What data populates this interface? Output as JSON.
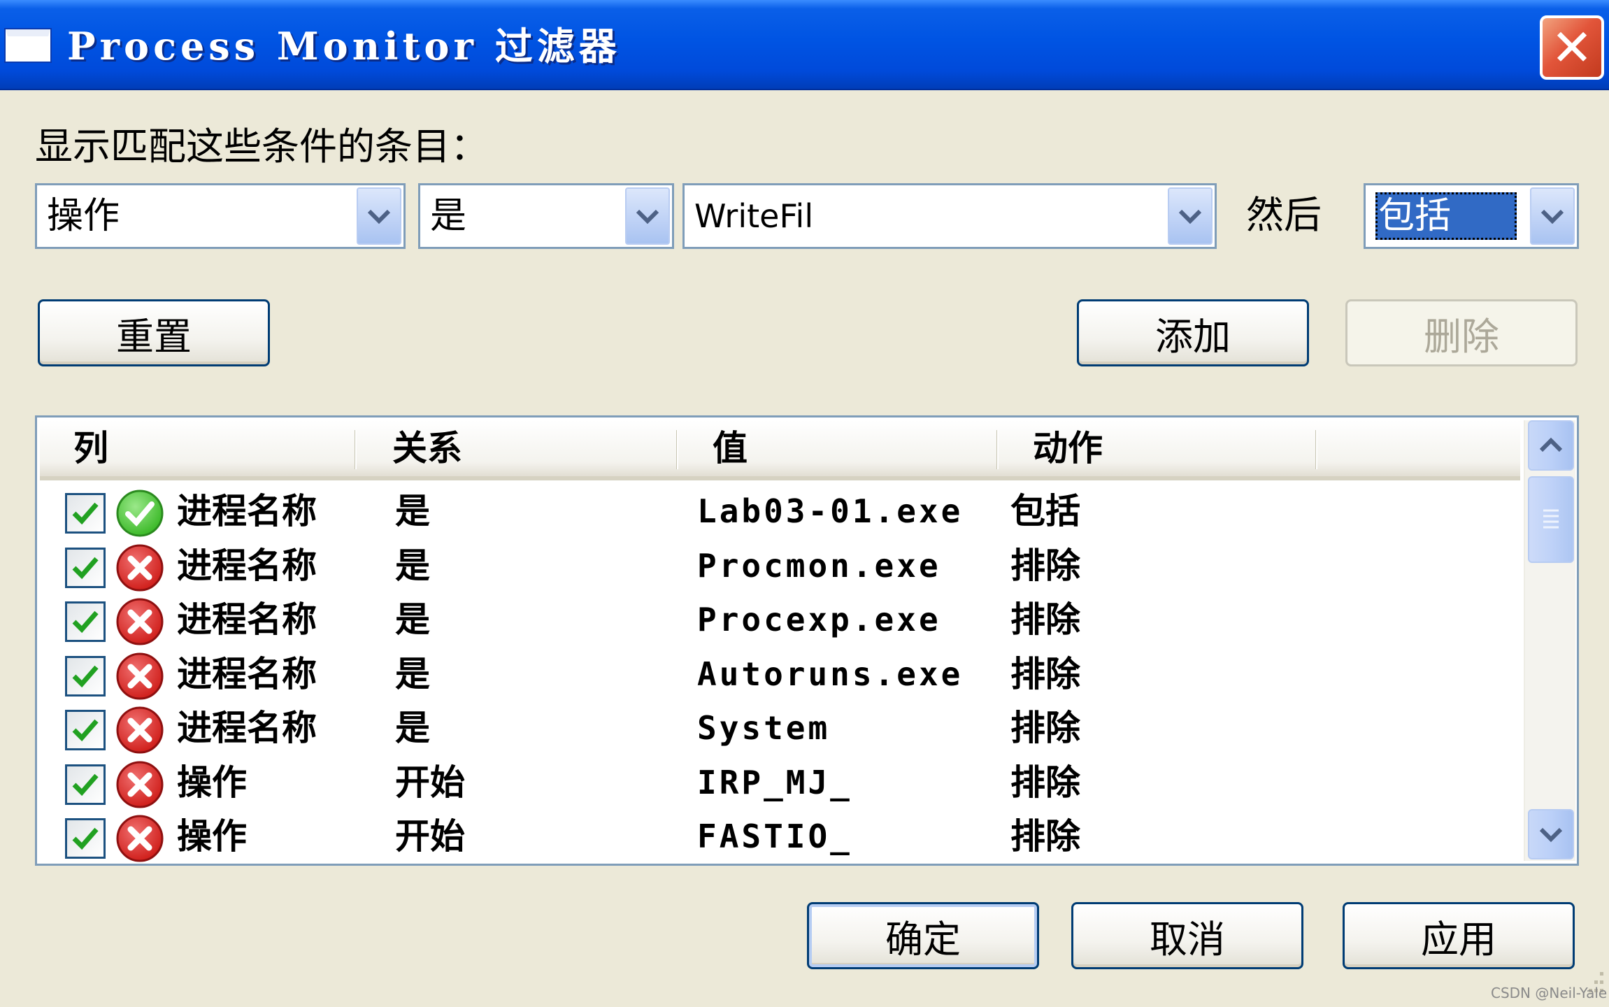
{
  "window": {
    "title": "Process Monitor 过滤器",
    "close_label": "✕"
  },
  "filter": {
    "caption": "显示匹配这些条件的条目：",
    "column_value": "操作",
    "relation_value": "是",
    "value_input": "WriteFil",
    "then_label": "然后",
    "action_value": "包括"
  },
  "buttons": {
    "reset": "重置",
    "add": "添加",
    "remove": "删除",
    "ok": "确定",
    "cancel": "取消",
    "apply": "应用"
  },
  "list": {
    "headers": [
      "列",
      "关系",
      "值",
      "动作"
    ],
    "rows": [
      {
        "checked": true,
        "status": "include",
        "column": "进程名称",
        "relation": "是",
        "value": "Lab03-01.exe",
        "action": "包括"
      },
      {
        "checked": true,
        "status": "exclude",
        "column": "进程名称",
        "relation": "是",
        "value": "Procmon.exe",
        "action": "排除"
      },
      {
        "checked": true,
        "status": "exclude",
        "column": "进程名称",
        "relation": "是",
        "value": "Procexp.exe",
        "action": "排除"
      },
      {
        "checked": true,
        "status": "exclude",
        "column": "进程名称",
        "relation": "是",
        "value": "Autoruns.exe",
        "action": "排除"
      },
      {
        "checked": true,
        "status": "exclude",
        "column": "进程名称",
        "relation": "是",
        "value": "System",
        "action": "排除"
      },
      {
        "checked": true,
        "status": "exclude",
        "column": "操作",
        "relation": "开始",
        "value": "IRP_MJ_",
        "action": "排除"
      },
      {
        "checked": true,
        "status": "exclude",
        "column": "操作",
        "relation": "开始",
        "value": "FASTIO_",
        "action": "排除"
      }
    ]
  },
  "watermark": "CSDN @Neil-Yale",
  "colors": {
    "titlebar": "#0054E3",
    "dialog_bg": "#ECE9D8",
    "selection": "#316AC5",
    "include_icon": "#3DBA2A",
    "exclude_icon": "#D0201C",
    "check": "#21A121"
  },
  "icons": {
    "include": "green-check-circle-icon",
    "exclude": "red-x-circle-icon"
  }
}
